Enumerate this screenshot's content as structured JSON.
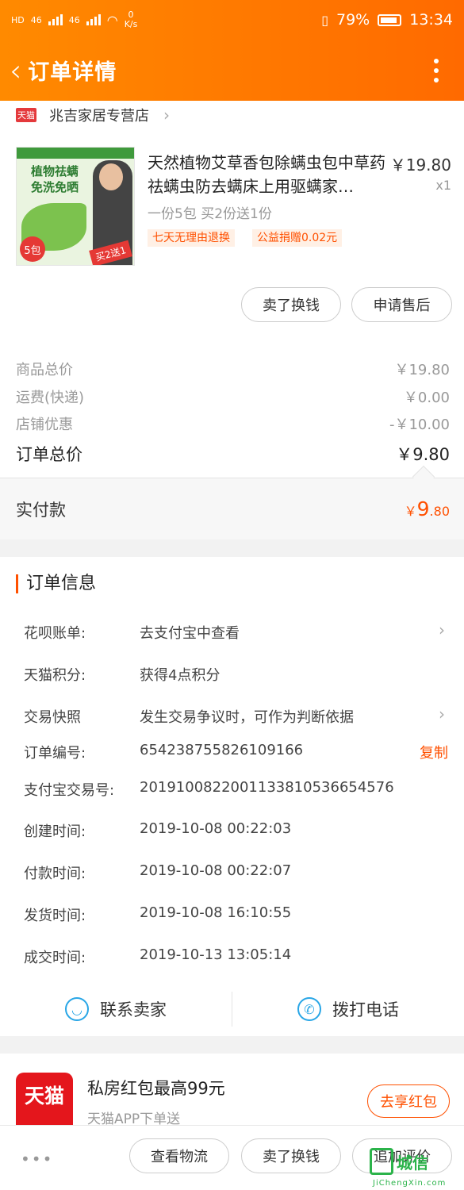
{
  "status_bar": {
    "network_left": "HD",
    "network_type_1": "46",
    "network_type_2": "46",
    "speed_value": "0",
    "speed_unit": "K/s",
    "battery": "79%",
    "time": "13:34"
  },
  "nav": {
    "title": "订单详情"
  },
  "store": {
    "badge": "天猫",
    "name": "兆吉家居专营店"
  },
  "product": {
    "image_top_text": "植物祛螨",
    "image_top_text2": "免洗免晒",
    "image_pack": "5包",
    "image_promo": "买2送1",
    "title": "天然植物艾草香包除螨虫包中草药祛螨虫防去螨床上用驱螨家…",
    "price": "￥19.80",
    "qty": "x1",
    "sku": "一份5包 买2份送1份",
    "tags": [
      "七天无理由退换",
      "公益捐赠0.02元"
    ]
  },
  "actions": {
    "sell_exchange": "卖了换钱",
    "after_sale": "申请售后"
  },
  "prices": {
    "goods_total_label": "商品总价",
    "goods_total_value": "￥19.80",
    "shipping_label": "运费(快递)",
    "shipping_value": "￥0.00",
    "discount_label": "店铺优惠",
    "discount_value": "-￥10.00",
    "order_total_label": "订单总价",
    "order_total_value": "￥9.80",
    "paid_label": "实付款",
    "paid_currency": "￥",
    "paid_integer": "9",
    "paid_decimal": ".80"
  },
  "order_info": {
    "title": "订单信息",
    "rows": [
      {
        "label": "花呗账单:",
        "value": "去支付宝中查看"
      },
      {
        "label": "天猫积分:",
        "value": "获得4点积分"
      },
      {
        "label": "交易快照",
        "value": "发生交易争议时，可作为判断依据"
      },
      {
        "label": "订单编号:",
        "value": "654238755826109166"
      },
      {
        "label": "支付宝交易号:",
        "value": "2019100822001133810536654576"
      },
      {
        "label": "创建时间:",
        "value": "2019-10-08 00:22:03"
      },
      {
        "label": "付款时间:",
        "value": "2019-10-08 00:22:07"
      },
      {
        "label": "发货时间:",
        "value": "2019-10-08 16:10:55"
      },
      {
        "label": "成交时间:",
        "value": "2019-10-13 13:05:14"
      }
    ],
    "copy_label": "复制"
  },
  "contact": {
    "seller": "联系卖家",
    "phone": "拨打电话"
  },
  "promo": {
    "logo_text": "天猫",
    "title": "私房红包最高99元",
    "subtitle": "天猫APP下单送",
    "button": "去享红包"
  },
  "bottom_bar": {
    "more": "•••",
    "logistics": "查看物流",
    "sell_exchange": "卖了换钱",
    "review": "追加评价"
  },
  "watermark": {
    "text": "城信",
    "sub": "JiChengXin.com"
  },
  "colors": {
    "brand": "#ff6a00",
    "accent": "#ff5000",
    "tmall_red": "#e4161c"
  }
}
